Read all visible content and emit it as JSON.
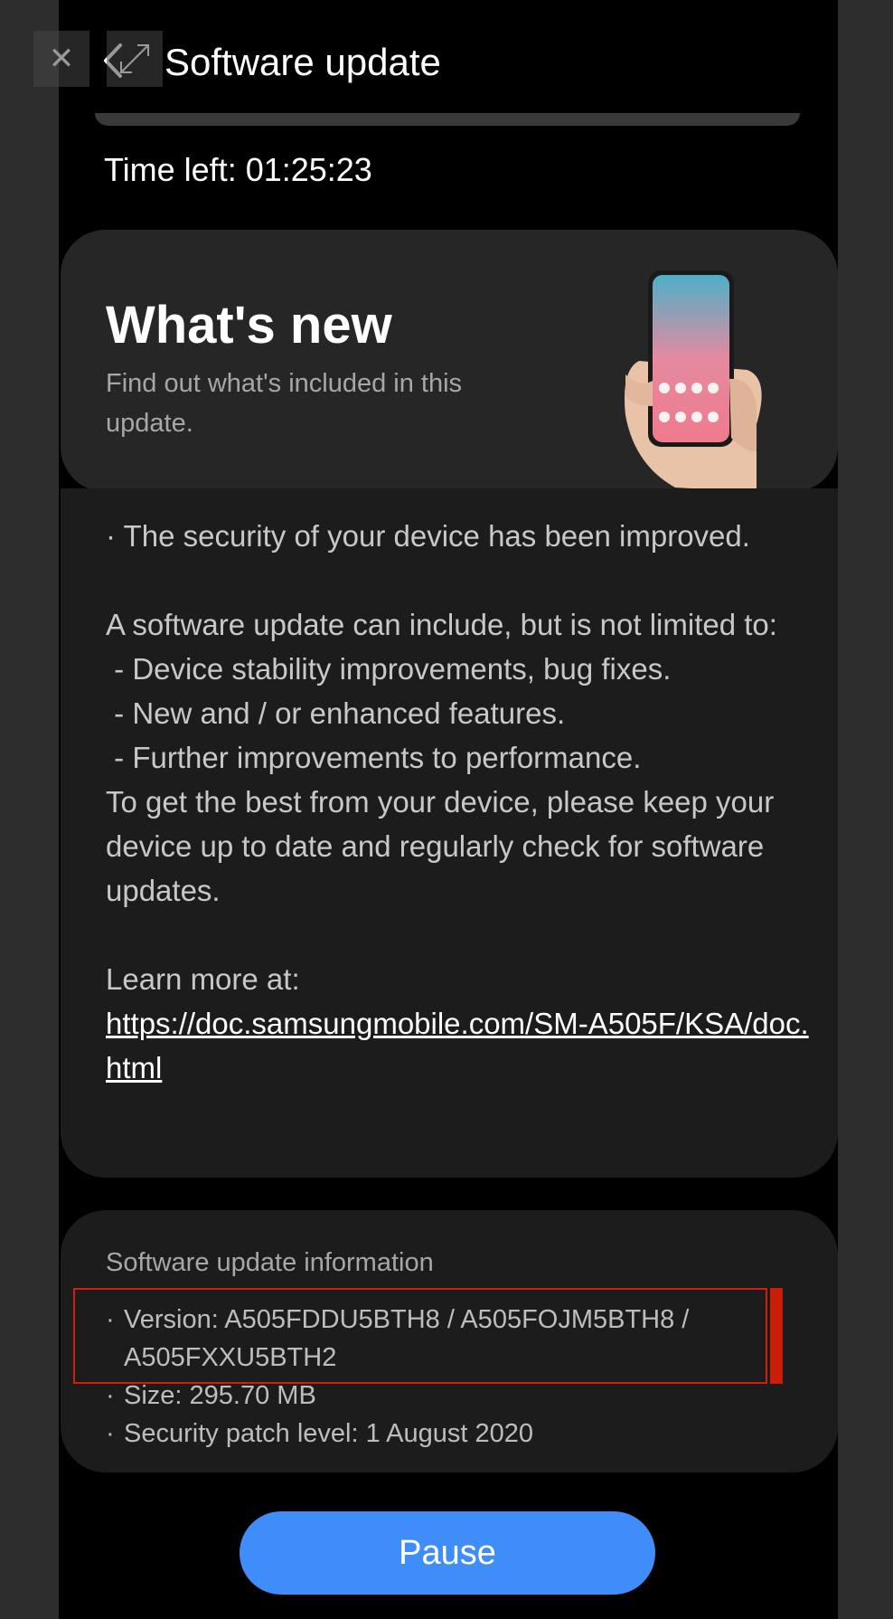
{
  "header": {
    "title": "Software update"
  },
  "progress": {
    "time_left": "Time left: 01:25:23"
  },
  "whats_new": {
    "title": "What's new",
    "subtitle": "Find out what's included in this update."
  },
  "notes": {
    "security": "· The security of your device has been improved.",
    "intro": "A software update can include, but is not limited to:",
    "item1": " - Device stability improvements, bug fixes.",
    "item2": " - New and / or enhanced features.",
    "item3": " - Further improvements to performance.",
    "outro": "To get the best from your device, please keep your device up to date and regularly check for software updates.",
    "learn_more": "Learn more at:",
    "link": "https://doc.samsungmobile.com/SM-A505F/KSA/doc.html"
  },
  "info": {
    "title": "Software update information",
    "version": "Version: A505FDDU5BTH8 / A505FOJM5BTH8 / A505FXXU5BTH2",
    "size": "Size: 295.70 MB",
    "patch": "Security patch level: 1 August 2020"
  },
  "actions": {
    "pause_label": "Pause"
  },
  "colors": {
    "accent": "#3f8df8",
    "highlight": "#d61d08",
    "background": "#000000"
  },
  "icons": {
    "close": "close-icon",
    "expand": "expand-icon",
    "back": "back-arrow-icon"
  }
}
